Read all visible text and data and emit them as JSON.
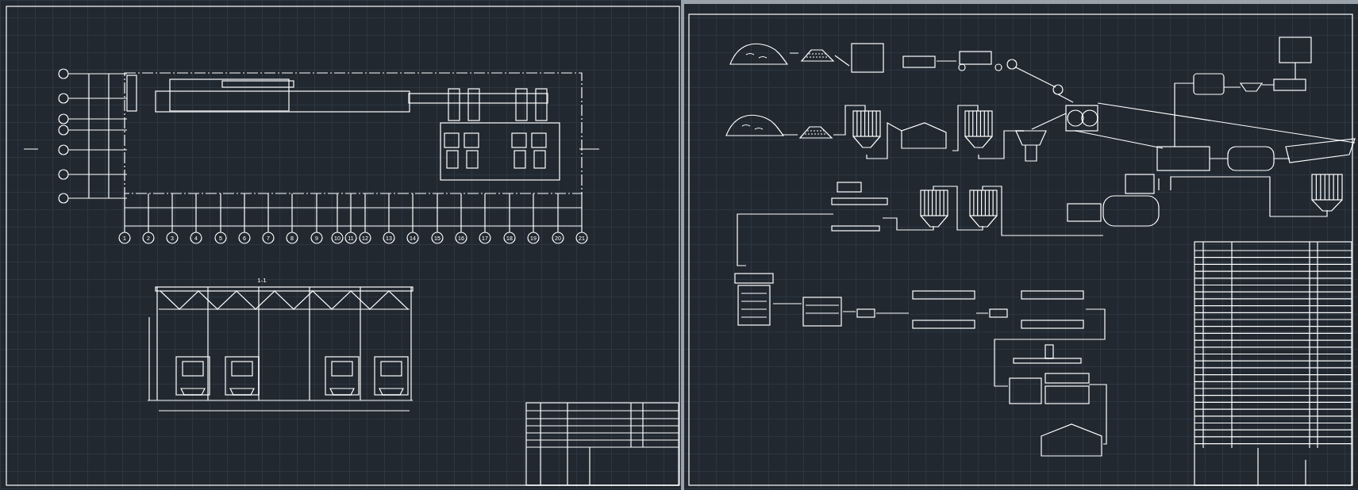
{
  "plan": {
    "column_axes": [
      "1",
      "2",
      "3",
      "4",
      "5",
      "6",
      "7",
      "8",
      "9",
      "10",
      "11",
      "12",
      "13",
      "14",
      "15",
      "16",
      "17",
      "18",
      "19",
      "20",
      "21"
    ]
  },
  "section": {
    "label": "1-1"
  }
}
